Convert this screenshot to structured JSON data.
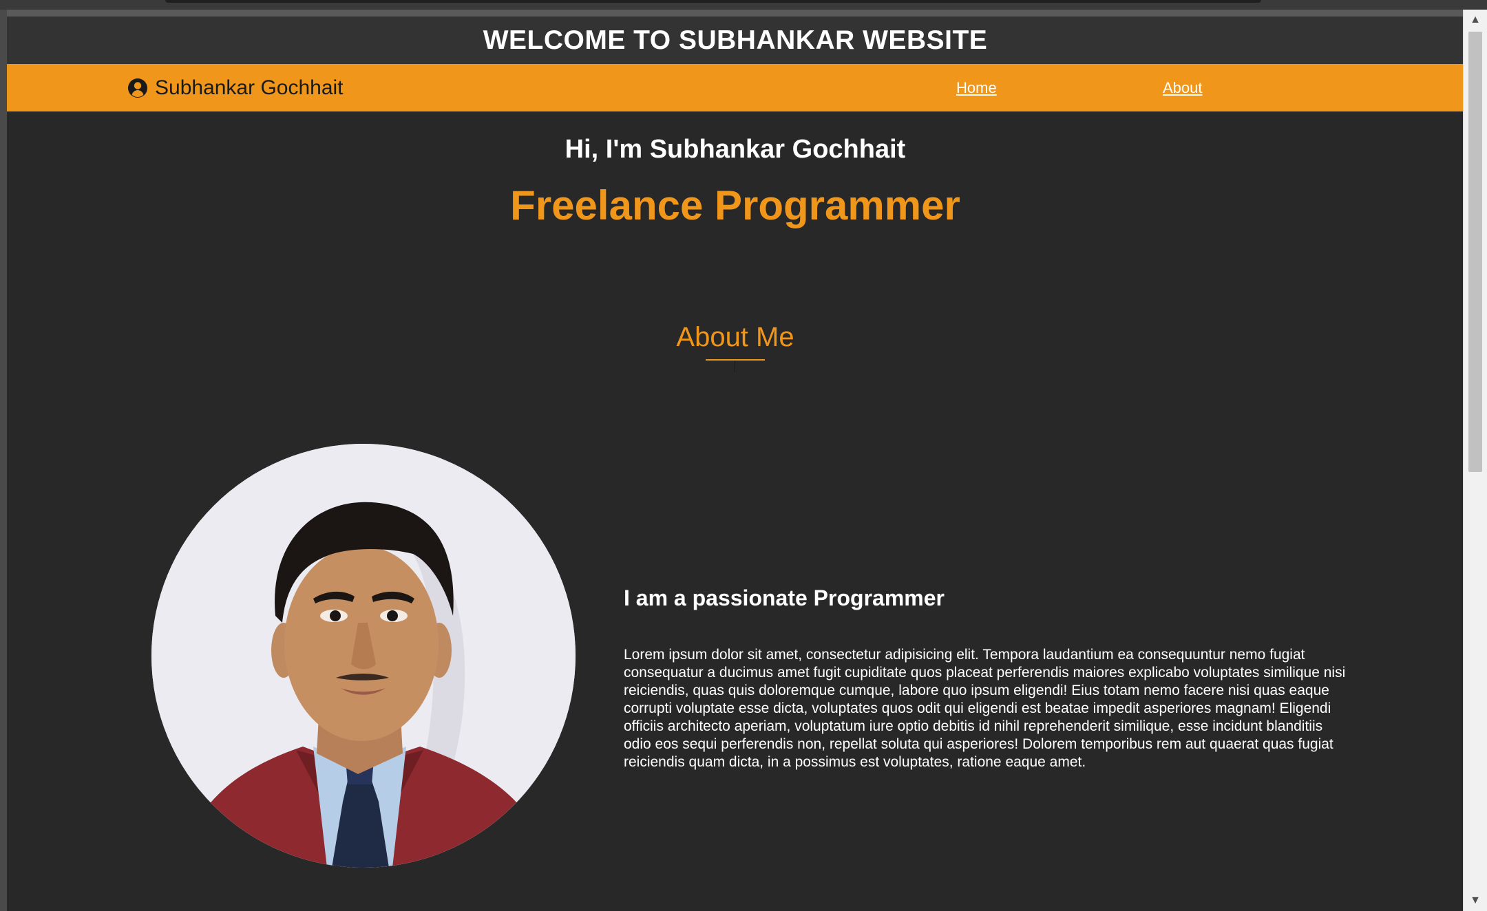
{
  "header": {
    "banner_title": "WELCOME TO SUBHANKAR WEBSITE"
  },
  "navbar": {
    "brand_name": "Subhankar Gochhait",
    "brand_icon": "user-circle-icon",
    "links": [
      {
        "label": "Home"
      },
      {
        "label": "About"
      }
    ],
    "background_color": "#f0961a"
  },
  "hero": {
    "greeting": "Hi, I'm Subhankar Gochhait",
    "role": "Freelance Programmer"
  },
  "about": {
    "section_title": "About Me",
    "heading": "I am a passionate Programmer",
    "paragraph": "Lorem ipsum dolor sit amet, consectetur adipisicing elit. Tempora laudantium ea consequuntur nemo fugiat consequatur a ducimus amet fugit cupiditate quos placeat perferendis maiores explicabo voluptates similique nisi reiciendis, quas quis doloremque cumque, labore quo ipsum eligendi! Eius totam nemo facere nisi quas eaque corrupti voluptate esse dicta, voluptates quos odit qui eligendi est beatae impedit asperiores magnam! Eligendi officiis architecto aperiam, voluptatum iure optio debitis id nihil reprehenderit similique, esse incidunt blanditiis odio eos sequi perferendis non, repellat soluta qui asperiores! Dolorem temporibus rem aut quaerat quas fugiat reiciendis quam dicta, in a possimus est voluptates, ratione eaque amet."
  },
  "theme": {
    "accent": "#f0961a",
    "page_background": "#282828",
    "banner_background": "#333333"
  }
}
